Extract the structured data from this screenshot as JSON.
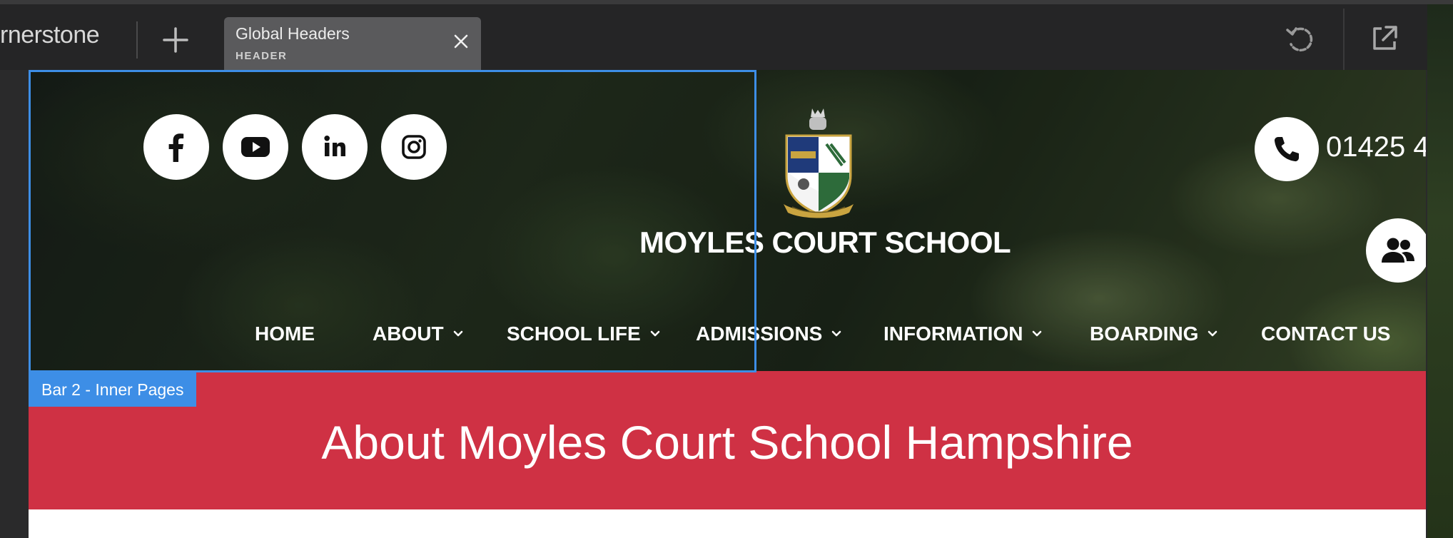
{
  "editor": {
    "brand": "rnerstone",
    "tab": {
      "title": "Global Headers",
      "subtitle": "HEADER"
    },
    "icons": [
      "plus-icon",
      "close-icon",
      "reload-icon",
      "popout-icon"
    ]
  },
  "site": {
    "social_icons": [
      "facebook-icon",
      "youtube-icon",
      "linkedin-icon",
      "instagram-icon"
    ],
    "school_name": "MOYLES COURT SCHOOL",
    "phone": "01425 4",
    "nav": [
      {
        "label": "HOME",
        "has_dropdown": false
      },
      {
        "label": "ABOUT",
        "has_dropdown": true
      },
      {
        "label": "SCHOOL LIFE",
        "has_dropdown": true
      },
      {
        "label": "ADMISSIONS",
        "has_dropdown": true
      },
      {
        "label": "INFORMATION",
        "has_dropdown": true
      },
      {
        "label": "BOARDING",
        "has_dropdown": true
      },
      {
        "label": "CONTACT US",
        "has_dropdown": false
      }
    ],
    "selection_label": "Bar 2 - Inner Pages",
    "page_title": "About Moyles Court School Hampshire"
  },
  "colors": {
    "selection": "#3d8ee6",
    "title_band": "#cf3144",
    "editor_bg": "#252526",
    "tab_bg": "#5a5a5c"
  }
}
